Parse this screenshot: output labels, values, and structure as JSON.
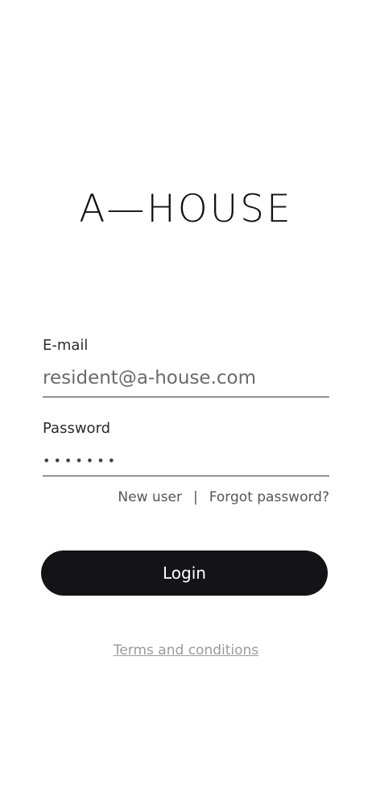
{
  "logo": {
    "text": "A—HOUSE"
  },
  "form": {
    "email_label": "E-mail",
    "email_value": "resident@a-house.com",
    "password_label": "Password",
    "password_value": "•••••••"
  },
  "links": {
    "new_user": "New user",
    "separator": "|",
    "forgot_password": "Forgot password?"
  },
  "login_button": {
    "label": "Login"
  },
  "terms": {
    "label": "Terms and conditions"
  }
}
